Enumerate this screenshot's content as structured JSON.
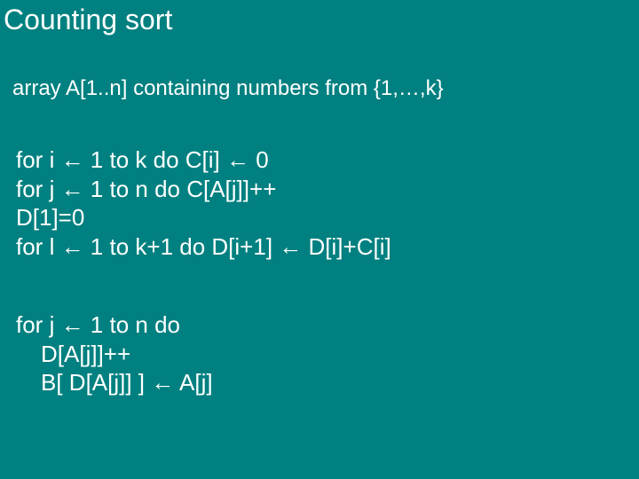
{
  "title": "Counting sort",
  "subtitle": "array A[1..n] containing numbers from {1,…,k}",
  "arrow": "←",
  "code1": {
    "l1_a": "for i ",
    "l1_b": " 1 to k do C[i] ",
    "l1_c": " 0",
    "l2_a": "for j ",
    "l2_b": " 1 to n do C[A[j]]++",
    "l3": "D[1]=0",
    "l4_a": "for l ",
    "l4_b": " 1 to k+1 do D[i+1] ",
    "l4_c": " D[i]+C[i]"
  },
  "code2": {
    "l1_a": "for j ",
    "l1_b": " 1 to n do",
    "l2": "D[A[j]]++",
    "l3_a": "B[ D[A[j]] ] ",
    "l3_b": " A[j]"
  }
}
